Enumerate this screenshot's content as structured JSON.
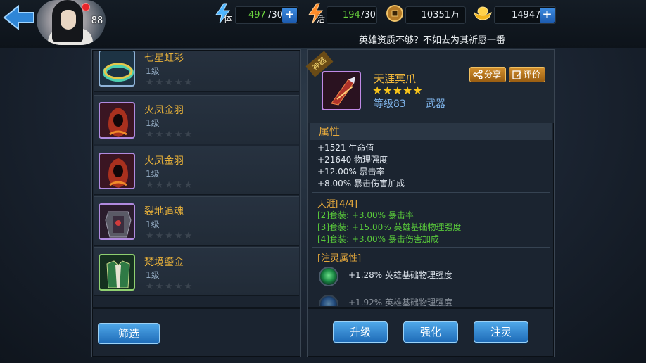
{
  "player": {
    "level": "88"
  },
  "resources": {
    "stamina_label": "体",
    "stamina_current": "497",
    "stamina_max": "/30",
    "vitality_label": "活",
    "vitality_current": "194",
    "vitality_max": "/30",
    "coins": "10351万",
    "ingots": "14947"
  },
  "marquee": "英雄资质不够？不如去为其祈愿一番",
  "item_list": [
    {
      "name": "七星虹彩",
      "level": "1级",
      "stars": "★★★★★"
    },
    {
      "name": "火凤金羽",
      "level": "1级",
      "stars": "★★★★★"
    },
    {
      "name": "火凤金羽",
      "level": "1级",
      "stars": "★★★★★"
    },
    {
      "name": "裂地追魂",
      "level": "1级",
      "stars": "★★★★★"
    },
    {
      "name": "梵境鎏金",
      "level": "1级",
      "stars": "★★★★★"
    }
  ],
  "filter_button": "筛选",
  "detail": {
    "tag": "神器",
    "name": "天涯冥爪",
    "stars": "★★★★★",
    "level": "等级83",
    "type": "武器",
    "share_button": "分享",
    "review_button": "评价",
    "attr_title": "属性",
    "attributes": [
      "+1521 生命值",
      "+21640 物理强度",
      "+12.00% 暴击率",
      "+8.00% 暴击伤害加成"
    ],
    "set_title": "天涯[4/4]",
    "set_bonuses": [
      "[2]套装: +3.00% 暴击率",
      "[3]套装: +15.00% 英雄基础物理强度",
      "[4]套装: +3.00% 暴击伤害加成"
    ],
    "inject_title": "[注灵属性]",
    "inject_attributes": [
      "+1.28% 英雄基础物理强度",
      "+1.92% 英雄基础物理强度"
    ]
  },
  "actions": {
    "upgrade": "升级",
    "enhance": "强化",
    "inject": "注灵"
  }
}
